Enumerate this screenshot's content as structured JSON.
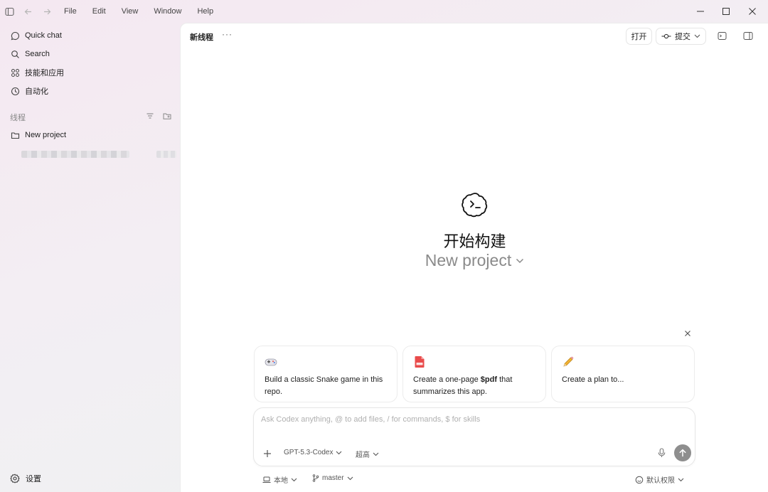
{
  "titlebar": {
    "menu": [
      "File",
      "Edit",
      "View",
      "Window",
      "Help"
    ],
    "icons": [
      "sidebar-toggle-icon",
      "back-arrow-icon",
      "forward-arrow-icon",
      "minimize-icon",
      "maximize-icon",
      "close-icon"
    ]
  },
  "sidebar": {
    "nav": [
      {
        "label": "Quick chat",
        "icon": "chat-bubble-icon"
      },
      {
        "label": "Search",
        "icon": "search-icon"
      },
      {
        "label": "技能和应用",
        "icon": "apps-grid-icon"
      },
      {
        "label": "自动化",
        "icon": "clock-icon"
      }
    ],
    "section_label": "线程",
    "project": {
      "label": "New project",
      "icon": "folder-icon"
    },
    "settings_label": "设置"
  },
  "main": {
    "thread_title": "新线程",
    "more": "···",
    "open_label": "打开",
    "commit_label": "提交",
    "hero": {
      "title": "开始构建",
      "project": "New project"
    },
    "cards": [
      {
        "icon": "gamepad-icon",
        "text_before": "Build a classic Snake game in this repo.",
        "bold": "",
        "text_after": ""
      },
      {
        "icon": "pdf-icon",
        "text_before": "Create a one-page ",
        "bold": "$pdf",
        "text_after": " that summarizes this app."
      },
      {
        "icon": "pencil-icon",
        "text_before": "Create a plan to...",
        "bold": "",
        "text_after": ""
      }
    ],
    "composer": {
      "placeholder": "Ask Codex anything, @ to add files, / for commands, $ for skills",
      "model": "GPT-5.3-Codex",
      "effort": "超高"
    },
    "footer": {
      "env": "本地",
      "branch": "master",
      "permission": "默认权限"
    }
  },
  "colors": {
    "send_button": "#8e8e8e",
    "pdf_red": "#e94b4b"
  }
}
